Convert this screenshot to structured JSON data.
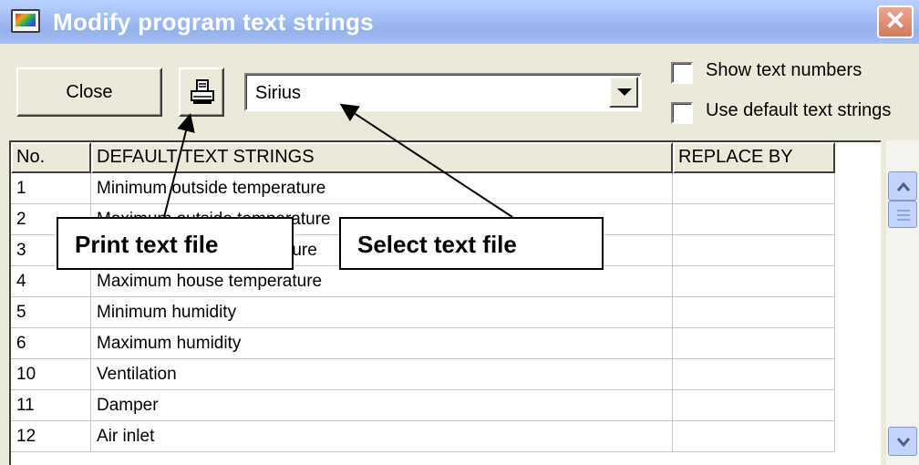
{
  "window": {
    "title": "Modify program text strings",
    "close_glyph": "✕"
  },
  "toolbar": {
    "close_label": "Close",
    "print_icon": "printer-icon",
    "combo_value": "Sirius",
    "show_text_numbers": {
      "label": "Show text numbers",
      "checked": false
    },
    "use_default_text_strings": {
      "label": "Use default text strings",
      "checked": false
    }
  },
  "grid": {
    "columns": [
      "No.",
      "DEFAULT TEXT STRINGS",
      "REPLACE BY"
    ],
    "rows": [
      {
        "no": "1",
        "text": "Minimum outside temperature",
        "replace": ""
      },
      {
        "no": "2",
        "text": "Maximum outside temperature",
        "replace": ""
      },
      {
        "no": "3",
        "text": "Minimum house temperature",
        "replace": ""
      },
      {
        "no": "4",
        "text": "Maximum house temperature",
        "replace": ""
      },
      {
        "no": "5",
        "text": "Minimum humidity",
        "replace": ""
      },
      {
        "no": "6",
        "text": "Maximum humidity",
        "replace": ""
      },
      {
        "no": "10",
        "text": "Ventilation",
        "replace": ""
      },
      {
        "no": "11",
        "text": "Damper",
        "replace": ""
      },
      {
        "no": "12",
        "text": "Air inlet",
        "replace": ""
      }
    ]
  },
  "annotations": {
    "print_text_file": "Print text file",
    "select_text_file": "Select text file"
  },
  "colors": {
    "titlebar": "#a7c1f5",
    "window_bg": "#ece9d8",
    "close_btn": "#d6785f"
  }
}
